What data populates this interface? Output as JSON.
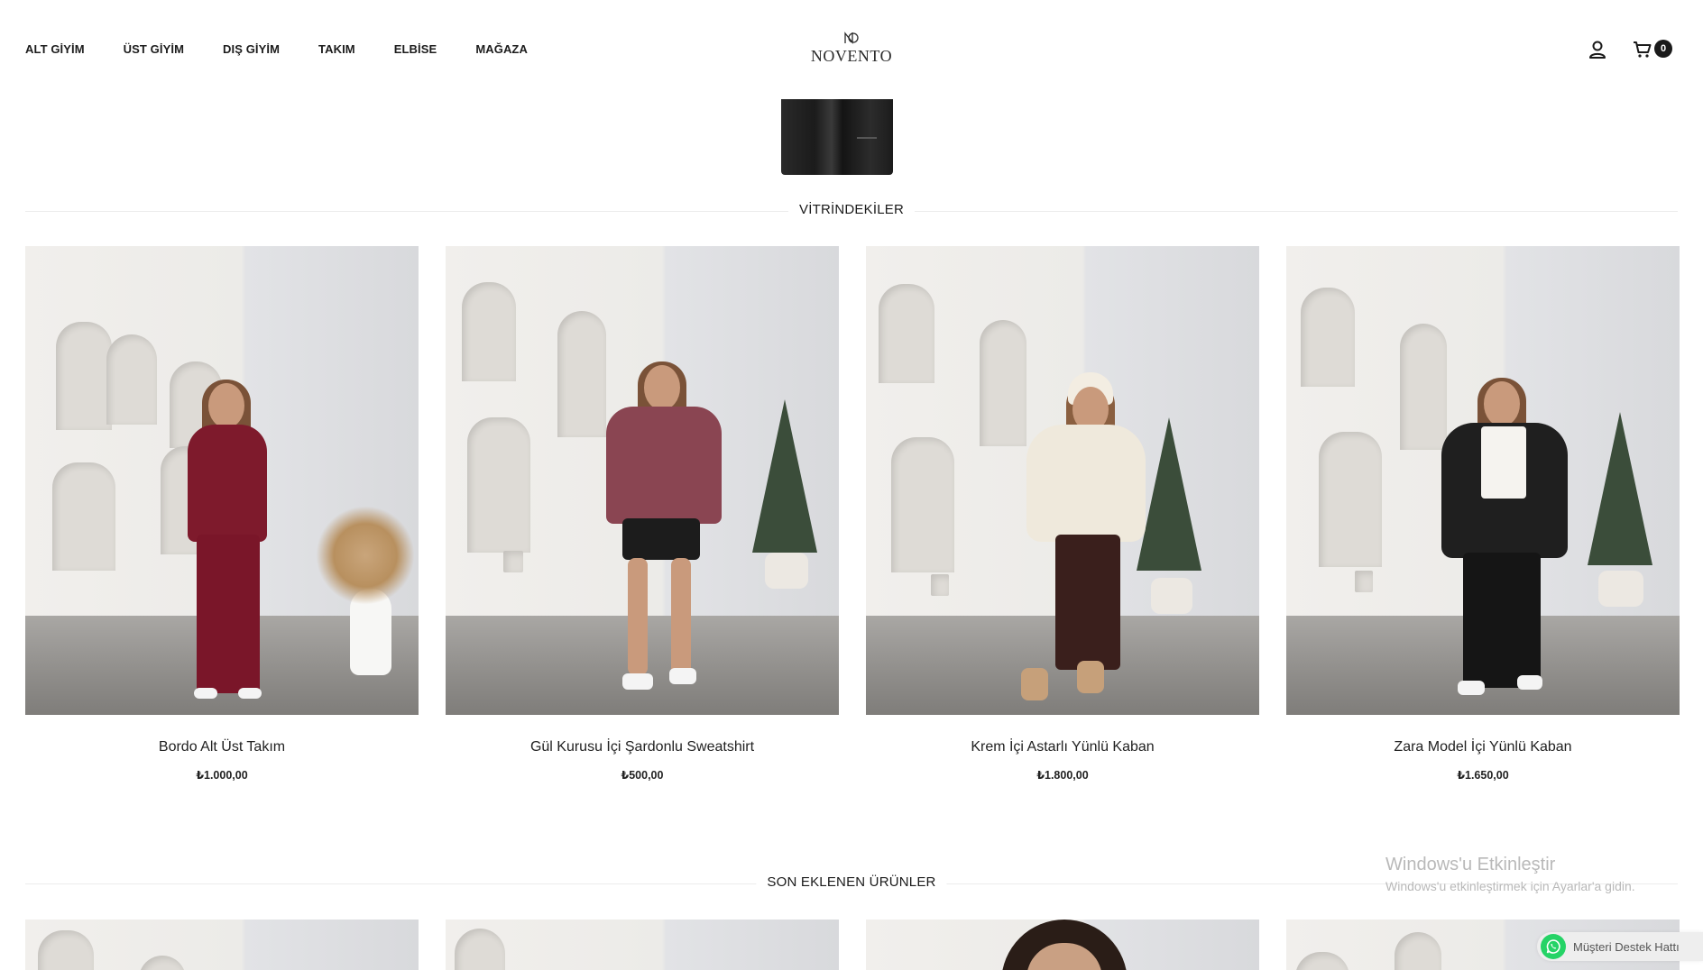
{
  "header": {
    "nav": [
      "ALT GİYİM",
      "ÜST GİYİM",
      "DIŞ GİYİM",
      "TAKIM",
      "ELBİSE",
      "MAĞAZA"
    ],
    "logo_text": "NOVENTO",
    "cart_count": "0"
  },
  "sections": {
    "featured_title": "VİTRİNDEKİLER",
    "recent_title": "SON EKLENEN ÜRÜNLER"
  },
  "featured_products": [
    {
      "name": "Bordo Alt Üst Takım",
      "price": "₺1.000,00",
      "top_color": "#7e1a2c",
      "bottom_color": "#7a1629"
    },
    {
      "name": "Gül Kurusu İçi Şardonlu Sweatshirt",
      "price": "₺500,00",
      "top_color": "#8a4552",
      "bottom_color": "#1c1c1c"
    },
    {
      "name": "Krem İçi Astarlı Yünlü Kaban",
      "price": "₺1.800,00",
      "top_color": "#efe9dc",
      "bottom_color": "#3a1f1c"
    },
    {
      "name": "Zara Model İçi Yünlü Kaban",
      "price": "₺1.650,00",
      "top_color": "#1f1f1f",
      "bottom_color": "#151515"
    }
  ],
  "overlays": {
    "windows_title": "Windows'u Etkinleştir",
    "windows_sub": "Windows'u etkinleştirmek için Ayarlar'a gidin.",
    "support_label": "Müşteri Destek Hattı"
  }
}
